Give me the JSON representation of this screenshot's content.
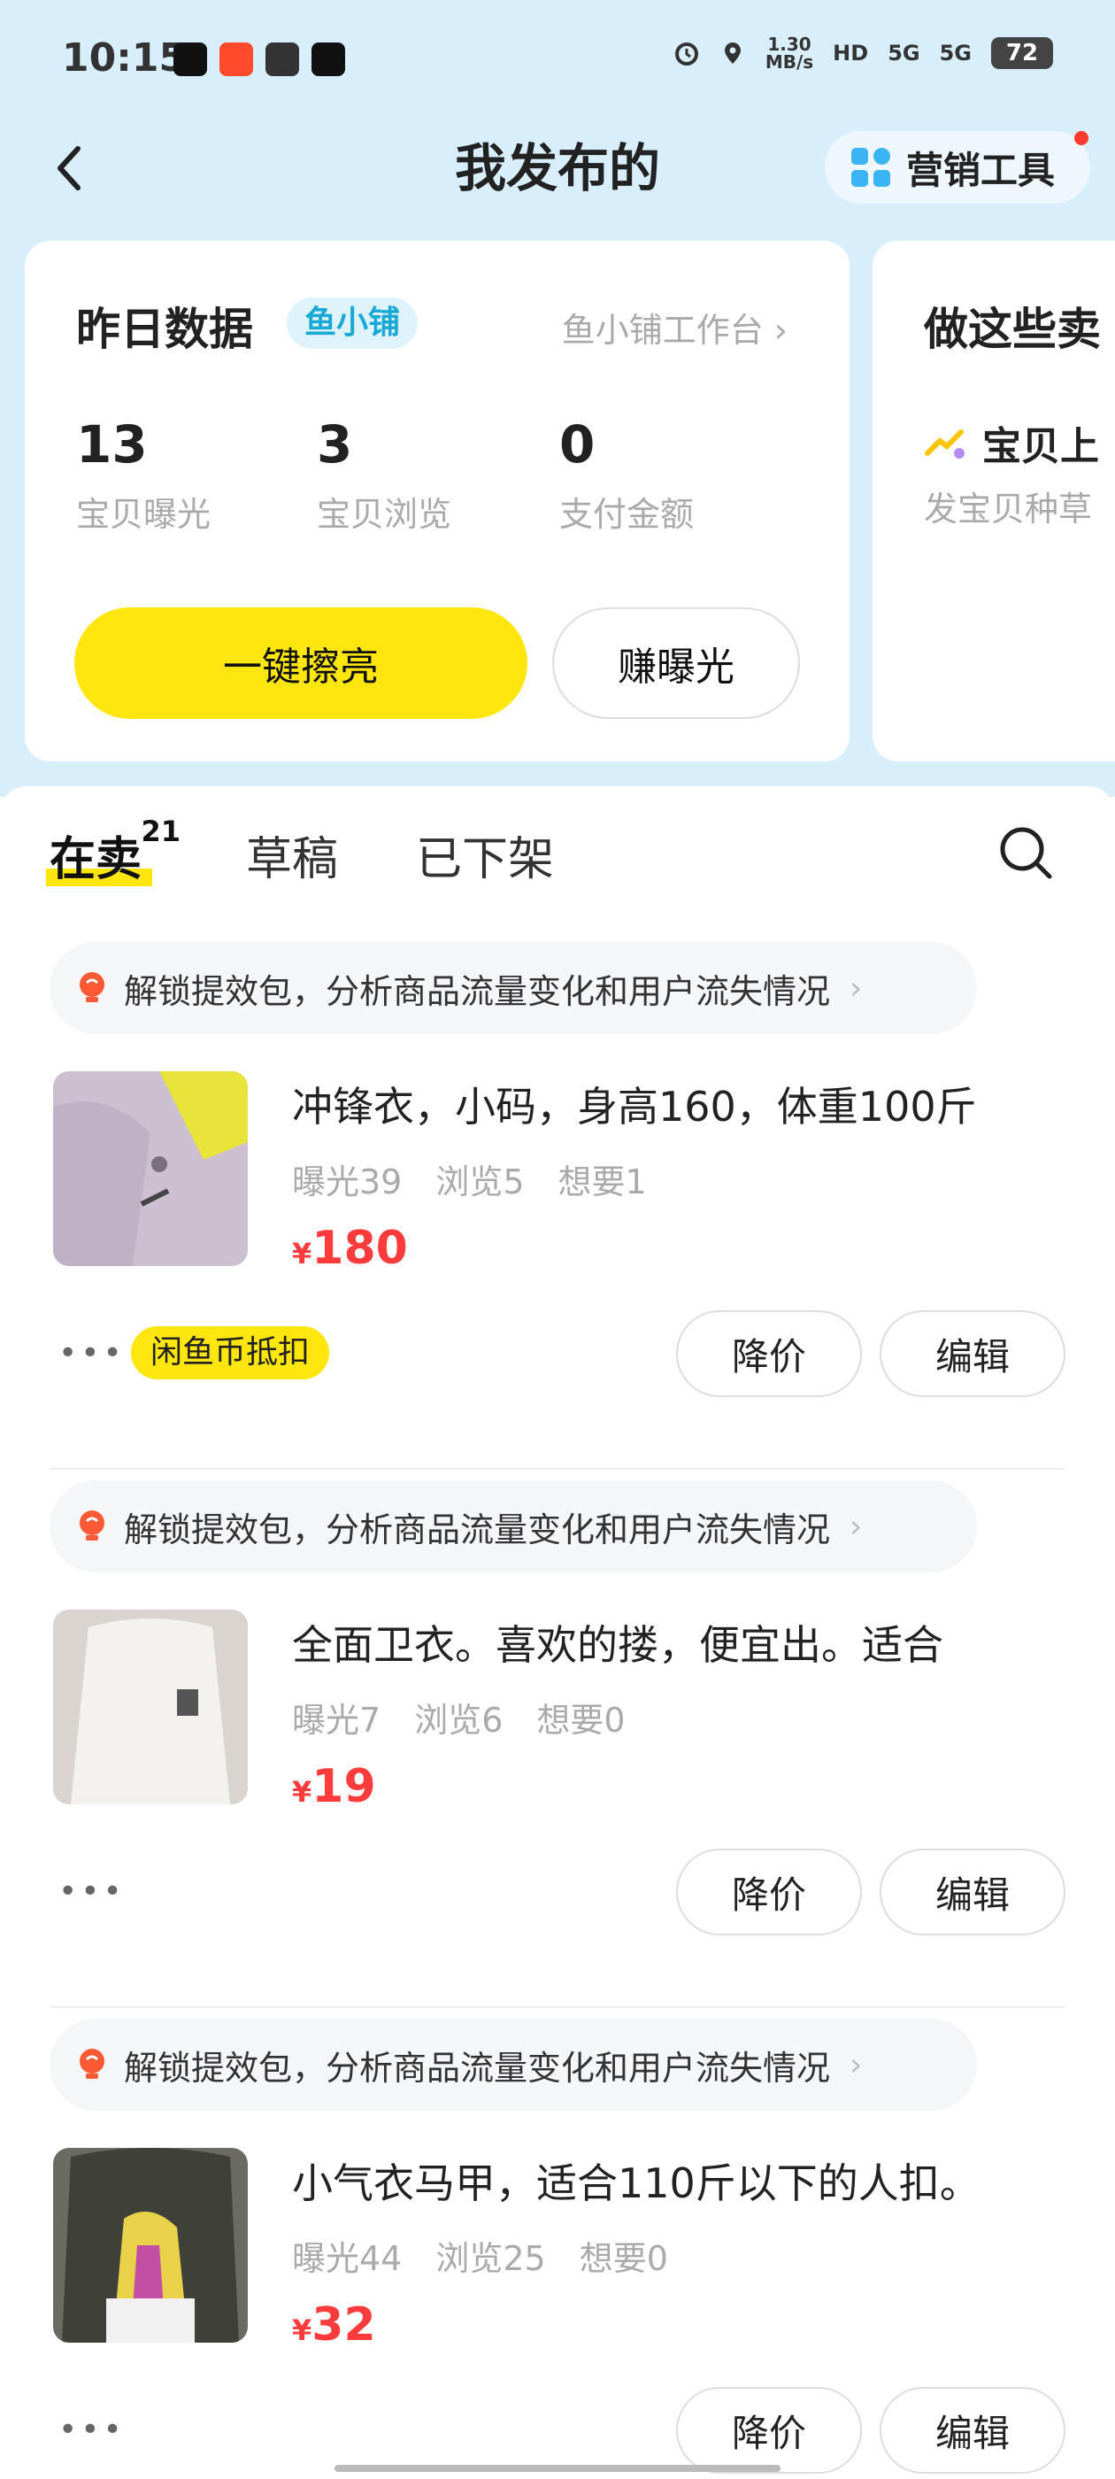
{
  "status_bar": {
    "time": "10:15",
    "net_speed": "1.30",
    "net_unit": "MB/s",
    "hd": "HD",
    "signal1": "5G",
    "signal2": "5G",
    "battery": "72"
  },
  "header": {
    "title": "我发布的",
    "tools_label": "营销工具"
  },
  "stats_card": {
    "title": "昨日数据",
    "shop_tag": "鱼小铺",
    "workbench_link": "鱼小铺工作台",
    "stats": [
      {
        "value": "13",
        "label": "宝贝曝光"
      },
      {
        "value": "3",
        "label": "宝贝浏览"
      },
      {
        "value": "0",
        "label": "支付金额"
      }
    ],
    "polish_button": "一键擦亮",
    "earn_button": "赚曝光"
  },
  "promo_card": {
    "title": "做这些卖",
    "row_text": "宝贝上",
    "sub_text": "发宝贝种草"
  },
  "tabs": {
    "selling": "在卖",
    "selling_count": "21",
    "drafts": "草稿",
    "offline": "已下架"
  },
  "items": [
    {
      "unlock_text": "解锁提效包，分析商品流量变化和用户流失情况",
      "title": "冲锋衣，小码，身高160，体重100斤",
      "exposure": "曝光39",
      "views": "浏览5",
      "wants": "想要1",
      "currency": "¥",
      "price": "180",
      "coin_tag": "闲鱼币抵扣",
      "reduce_button": "降价",
      "edit_button": "编辑"
    },
    {
      "unlock_text": "解锁提效包，分析商品流量变化和用户流失情况",
      "title": "全面卫衣。喜欢的搂，便宜出。适合",
      "exposure": "曝光7",
      "views": "浏览6",
      "wants": "想要0",
      "currency": "¥",
      "price": "19",
      "reduce_button": "降价",
      "edit_button": "编辑"
    },
    {
      "unlock_text": "解锁提效包，分析商品流量变化和用户流失情况",
      "title": "小气衣马甲，适合110斤以下的人扣。",
      "exposure": "曝光44",
      "views": "浏览25",
      "wants": "想要0",
      "currency": "¥",
      "price": "32",
      "reduce_button": "降价",
      "edit_button": "编辑"
    }
  ],
  "colors": {
    "accent_yellow": "#ffe60f",
    "price_red": "#ff3b3b",
    "header_bg": "#d8eefb"
  }
}
